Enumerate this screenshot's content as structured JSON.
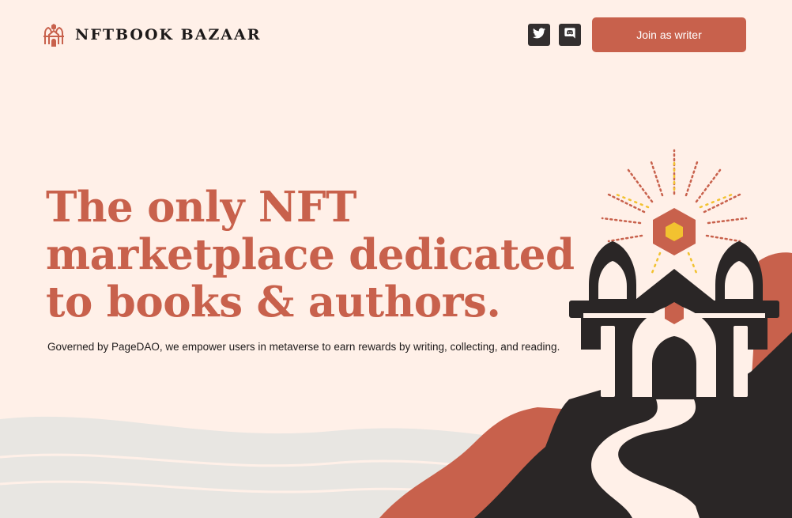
{
  "header": {
    "brand": "NFTBOOK BAZAAR",
    "logo_icon": "castle-logo-icon",
    "social": [
      {
        "icon": "twitter-icon"
      },
      {
        "icon": "discord-icon"
      }
    ],
    "cta_label": "Join as writer"
  },
  "hero": {
    "title": "The only NFT marketplace dedicated to books & authors.",
    "subtitle": "Governed by PageDAO, we empower users in metaverse to earn rewards by writing, collecting, and reading."
  },
  "colors": {
    "background": "#fff0e8",
    "accent": "#c8614c",
    "dark": "#2a2626",
    "highlight": "#f2c230"
  }
}
